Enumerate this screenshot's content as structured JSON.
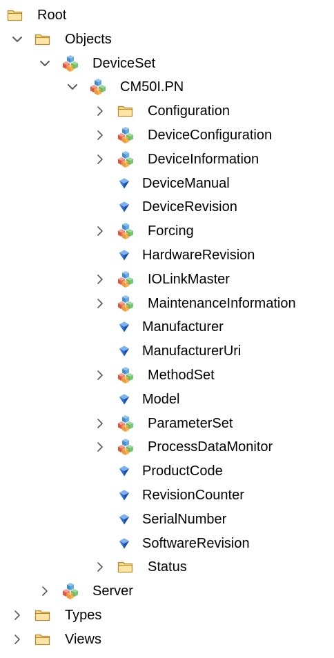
{
  "tree": {
    "nodes": [
      {
        "label": "Root",
        "depth": 0,
        "icon": "folder-icon",
        "expander": "none"
      },
      {
        "label": "Objects",
        "depth": 1,
        "icon": "folder-icon",
        "expander": "expanded"
      },
      {
        "label": "DeviceSet",
        "depth": 2,
        "icon": "object-icon",
        "expander": "expanded"
      },
      {
        "label": "CM50I.PN",
        "depth": 3,
        "icon": "object-icon",
        "expander": "expanded"
      },
      {
        "label": "Configuration",
        "depth": 4,
        "icon": "folder-icon",
        "expander": "collapsed"
      },
      {
        "label": "DeviceConfiguration",
        "depth": 4,
        "icon": "object-icon",
        "expander": "collapsed"
      },
      {
        "label": "DeviceInformation",
        "depth": 4,
        "icon": "object-icon",
        "expander": "collapsed"
      },
      {
        "label": "DeviceManual",
        "depth": 4,
        "icon": "variable-icon",
        "expander": "none"
      },
      {
        "label": "DeviceRevision",
        "depth": 4,
        "icon": "variable-icon",
        "expander": "none"
      },
      {
        "label": "Forcing",
        "depth": 4,
        "icon": "object-icon",
        "expander": "collapsed"
      },
      {
        "label": "HardwareRevision",
        "depth": 4,
        "icon": "variable-icon",
        "expander": "none"
      },
      {
        "label": "IOLinkMaster",
        "depth": 4,
        "icon": "object-icon",
        "expander": "collapsed"
      },
      {
        "label": "MaintenanceInformation",
        "depth": 4,
        "icon": "object-icon",
        "expander": "collapsed"
      },
      {
        "label": "Manufacturer",
        "depth": 4,
        "icon": "variable-icon",
        "expander": "none"
      },
      {
        "label": "ManufacturerUri",
        "depth": 4,
        "icon": "variable-icon",
        "expander": "none"
      },
      {
        "label": "MethodSet",
        "depth": 4,
        "icon": "object-icon",
        "expander": "collapsed"
      },
      {
        "label": "Model",
        "depth": 4,
        "icon": "variable-icon",
        "expander": "none"
      },
      {
        "label": "ParameterSet",
        "depth": 4,
        "icon": "object-icon",
        "expander": "collapsed"
      },
      {
        "label": "ProcessDataMonitor",
        "depth": 4,
        "icon": "object-icon",
        "expander": "collapsed"
      },
      {
        "label": "ProductCode",
        "depth": 4,
        "icon": "variable-icon",
        "expander": "none"
      },
      {
        "label": "RevisionCounter",
        "depth": 4,
        "icon": "variable-icon",
        "expander": "none"
      },
      {
        "label": "SerialNumber",
        "depth": 4,
        "icon": "variable-icon",
        "expander": "none"
      },
      {
        "label": "SoftwareRevision",
        "depth": 4,
        "icon": "variable-icon",
        "expander": "none"
      },
      {
        "label": "Status",
        "depth": 4,
        "icon": "folder-icon",
        "expander": "collapsed"
      },
      {
        "label": "Server",
        "depth": 2,
        "icon": "object-icon",
        "expander": "collapsed"
      },
      {
        "label": "Types",
        "depth": 1,
        "icon": "folder-icon",
        "expander": "collapsed"
      },
      {
        "label": "Views",
        "depth": 1,
        "icon": "folder-icon",
        "expander": "collapsed"
      }
    ]
  },
  "colors": {
    "expander": "#595959",
    "folder_fill": "#F5D77E",
    "folder_stroke": "#B8892F",
    "object_red": "#E2563B",
    "object_blue": "#3C8FD6",
    "object_green": "#4DB84A",
    "object_orange": "#F29A2E",
    "variable_blue": "#2B6FD1"
  }
}
